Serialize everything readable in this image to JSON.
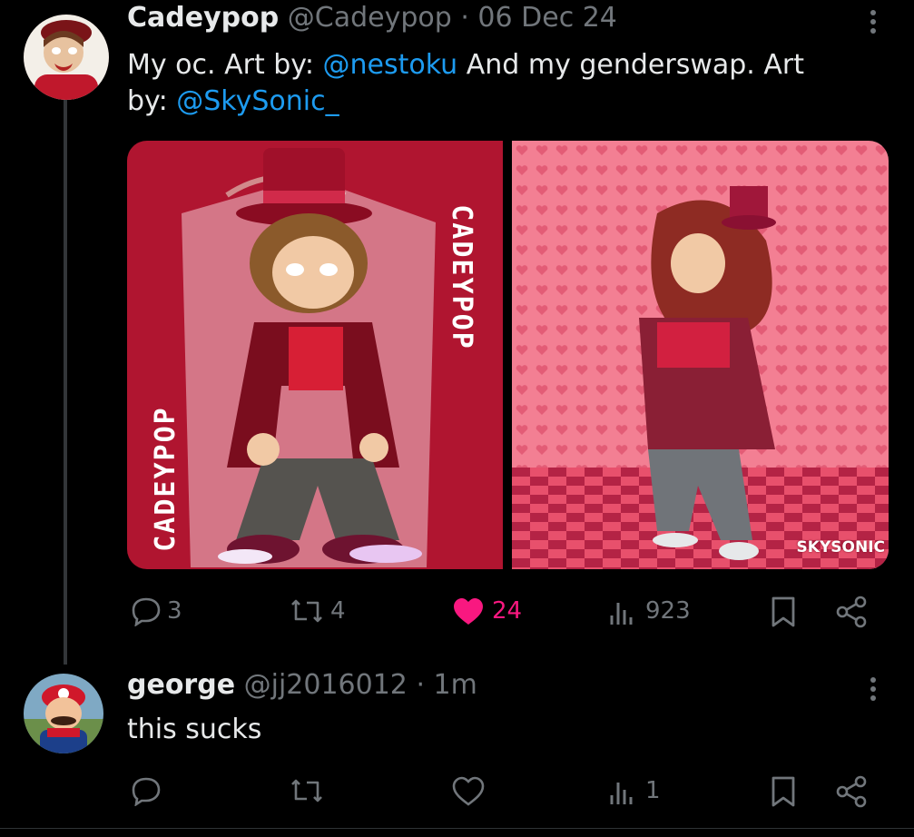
{
  "tweet": {
    "display_name": "Cadeypop",
    "handle": "@Cadeypop",
    "separator": "·",
    "date": "06 Dec 24",
    "text_1": "My oc. Art by: ",
    "mention_1": "@nestoku",
    "text_2": " And my genderswap. Art",
    "text_3": "by: ",
    "mention_2": "@SkySonic_",
    "image_1": {
      "vertical_label": "CADEYPOP"
    },
    "image_2": {
      "watermark": "SKYSONIC"
    },
    "actions": {
      "replies": "3",
      "reposts": "4",
      "likes": "24",
      "views": "923"
    }
  },
  "reply": {
    "display_name": "george",
    "handle": "@jj2016012",
    "separator": "·",
    "time": "1m",
    "text": "this sucks",
    "actions": {
      "views": "1"
    }
  },
  "colors": {
    "accent": "#1d9bf0",
    "like_active": "#f91880",
    "muted": "#71767b"
  }
}
